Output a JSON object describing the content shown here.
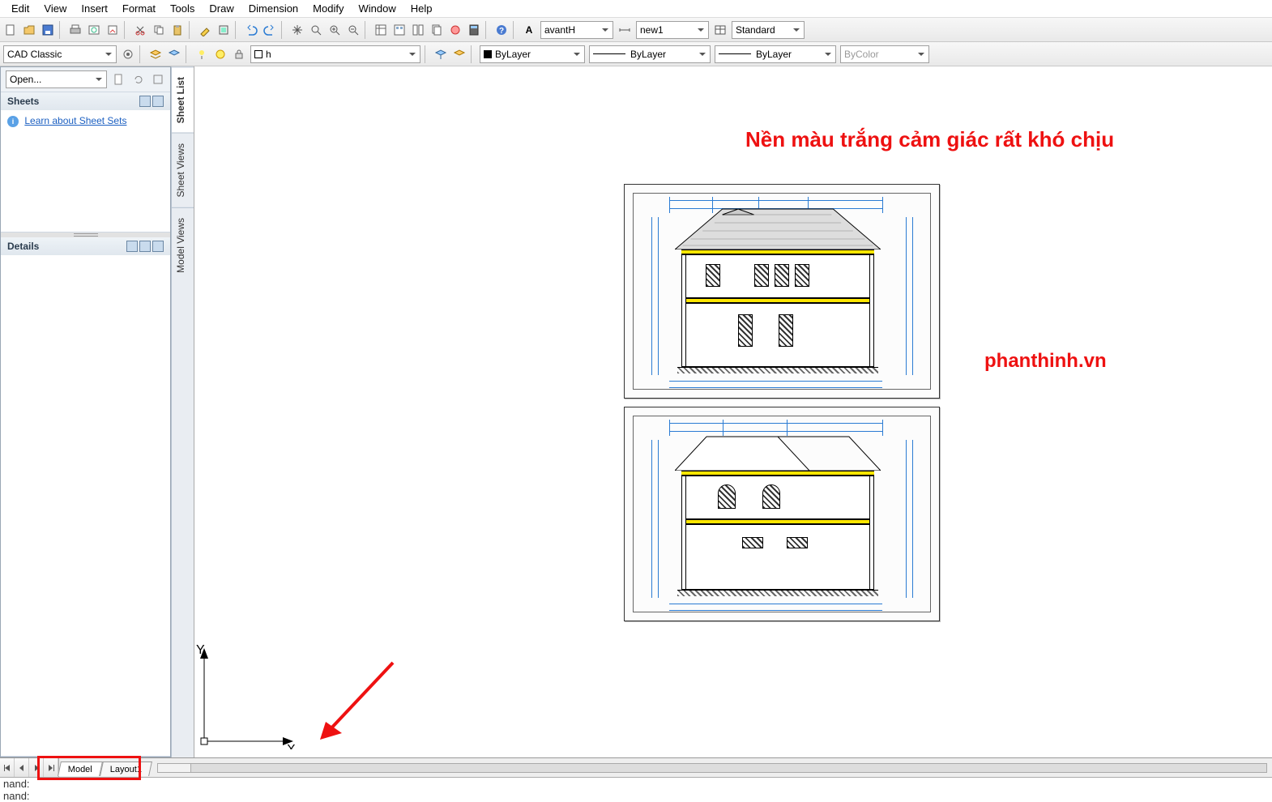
{
  "menu": [
    "Edit",
    "View",
    "Insert",
    "Format",
    "Tools",
    "Draw",
    "Dimension",
    "Modify",
    "Window",
    "Help"
  ],
  "toolbar1": {
    "workspace_combo": "CAD Classic",
    "font_combo": "avantH",
    "style_combo": "new1",
    "rightmost_combo": "Standard"
  },
  "toolbar2": {
    "layer_name": "h",
    "color_combo": "ByLayer",
    "linetype_combo": "ByLayer",
    "lineweight_combo": "ByLayer",
    "plotstyle_combo": "ByColor"
  },
  "sheet_panel": {
    "open_combo": "Open...",
    "sheets_header": "Sheets",
    "sheets_link": "Learn about Sheet Sets",
    "details_header": "Details"
  },
  "vtabs": {
    "sheet_list": "Sheet List",
    "sheet_views": "Sheet Views",
    "model_views": "Model Views"
  },
  "annotation_top": "Nền màu trắng cảm giác rất khó chịu",
  "watermark": "phanthinh.vn",
  "layout_tabs": {
    "model": "Model",
    "layout1": "Layout1"
  },
  "command": {
    "line1": "nand:",
    "line2": "nand:"
  },
  "ucs": {
    "y_label": "Y",
    "x_label": "X"
  }
}
